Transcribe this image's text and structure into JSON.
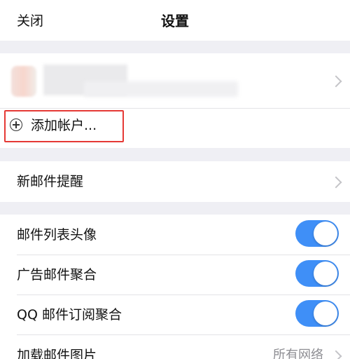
{
  "header": {
    "close_label": "关闭",
    "title": "设置"
  },
  "accounts": {
    "add_account_label": "添加帐户..."
  },
  "notifications": {
    "new_mail_alert_label": "新邮件提醒"
  },
  "settings": {
    "items": [
      {
        "label": "邮件列表头像",
        "toggle": true
      },
      {
        "label": "广告邮件聚合",
        "toggle": true
      },
      {
        "label": "QQ 邮件订阅聚合",
        "toggle": true
      }
    ],
    "load_images": {
      "label": "加载邮件图片",
      "value": "所有网络"
    }
  },
  "colors": {
    "toggle_on": "#3f8ff7",
    "highlight_box": "#e53935",
    "background": "#efeff4"
  },
  "icons": [
    "chevron-right-icon",
    "plus-circle-icon"
  ]
}
